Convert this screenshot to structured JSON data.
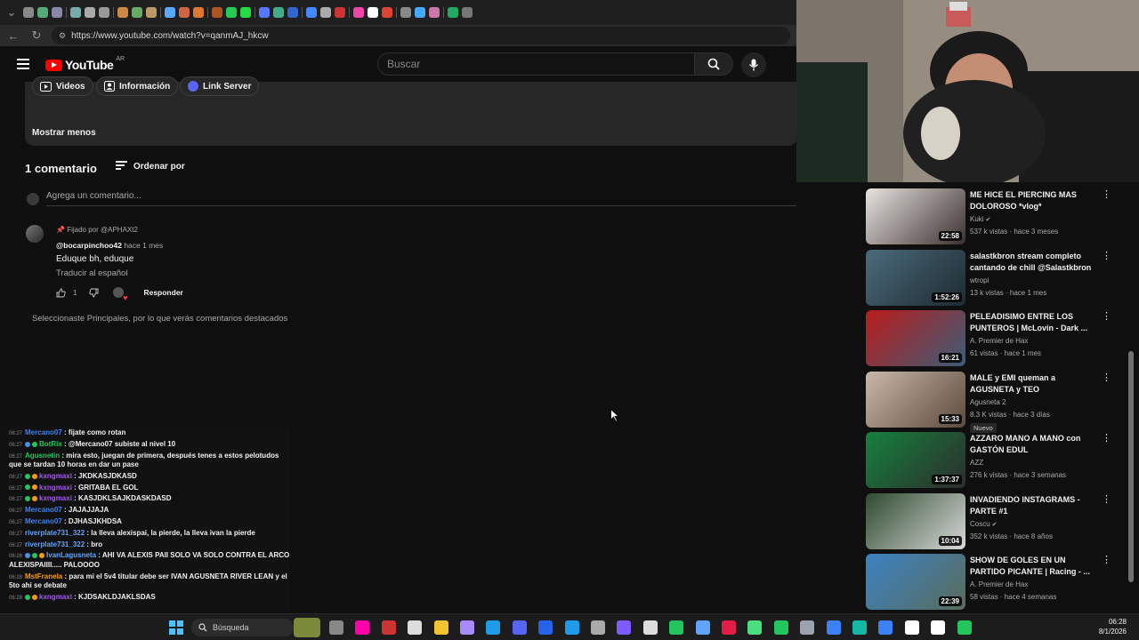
{
  "browser": {
    "url": "https://www.youtube.com/watch?v=qanmAJ_hkcw",
    "tab_icon_colors": [
      "#888",
      "#5a7",
      "#88a",
      "#7aa",
      "#aaa",
      "#999",
      "#c84",
      "#6a6",
      "#b96",
      "#5af",
      "#c64",
      "#d73",
      "#a52",
      "#2c5",
      "#2d4",
      "#57f",
      "#4a8",
      "#36c",
      "#48f",
      "#aaa",
      "#c33",
      "#e4a",
      "#fff",
      "#d43",
      "#888",
      "#4af",
      "#c7a",
      "#2a6",
      "#777"
    ]
  },
  "yt": {
    "logo_text": "YouTube",
    "region": "AR",
    "search_placeholder": "Buscar",
    "icons": {
      "menu": "hamburger-icon",
      "search": "search-icon",
      "mic": "mic-icon"
    }
  },
  "description": {
    "chips": [
      {
        "label": "Videos",
        "icon": "video-icon"
      },
      {
        "label": "Información",
        "icon": "person-icon"
      },
      {
        "label": "Link Server",
        "icon": "discord-icon"
      }
    ],
    "show_less": "Mostrar menos"
  },
  "comments": {
    "count_label": "1 comentario",
    "sort_label": "Ordenar por",
    "add_placeholder": "Agrega un comentario...",
    "filter_note": "Seleccionaste Principales, por lo que verás comentarios destacados",
    "items": [
      {
        "pinned": "Fijado por @APHAXt2",
        "author": "@bocarpinchoo42",
        "time": "hace 1 mes",
        "text": "Eduque bh, eduque",
        "translate": "Traducir al español",
        "likes": "1",
        "reply": "Responder"
      }
    ]
  },
  "chat": [
    {
      "time": "06:27",
      "user": "Mercano07",
      "color": "#3b82f6",
      "badges": [],
      "msg": ": fijate como rotan"
    },
    {
      "time": "06:27",
      "user": "BotRix",
      "color": "#22c55e",
      "badges": [
        "#4a90e2",
        "#22c55e"
      ],
      "msg": ": @Mercano07 subiste al nivel 10"
    },
    {
      "time": "06:27",
      "user": "Agusnetin",
      "color": "#22c55e",
      "badges": [],
      "msg": ": mira esto, juegan de primera, después tenes a estos pelotudos que se tardan 10 horas en dar un pase"
    },
    {
      "time": "06:27",
      "user": "kxngmaxi",
      "color": "#a855f7",
      "badges": [
        "#22c55e",
        "#f59e0b"
      ],
      "msg": ": JKDKASJDKASD"
    },
    {
      "time": "06:27",
      "user": "kxngmaxi",
      "color": "#a855f7",
      "badges": [
        "#22c55e",
        "#f59e0b"
      ],
      "msg": ": GRITABA EL GOL"
    },
    {
      "time": "06:27",
      "user": "kxngmaxi",
      "color": "#a855f7",
      "badges": [
        "#22c55e",
        "#f59e0b"
      ],
      "msg": ": KASJDKLSAJKDASKDASD"
    },
    {
      "time": "06:27",
      "user": "Mercano07",
      "color": "#3b82f6",
      "badges": [],
      "msg": ": JAJAJJAJA"
    },
    {
      "time": "06:27",
      "user": "Mercano07",
      "color": "#3b82f6",
      "badges": [],
      "msg": ": DJHASJKHDSA"
    },
    {
      "time": "06:27",
      "user": "riverplate731_322",
      "color": "#60a5fa",
      "badges": [],
      "msg": ": la lleva alexispai, la pierde, la lleva ivan la pierde"
    },
    {
      "time": "06:27",
      "user": "riverplate731_322",
      "color": "#60a5fa",
      "badges": [],
      "msg": ": bro"
    },
    {
      "time": "06:28",
      "user": "IvanLagusneta",
      "color": "#60a5fa",
      "badges": [
        "#4a90e2",
        "#22c55e",
        "#f59e0b"
      ],
      "msg": ": AHI VA ALEXIS PAII SOLO VA SOLO CONTRA EL ARCO ALEXISPAIIII..... PALOOOO"
    },
    {
      "time": "06:28",
      "user": "MstFranela",
      "color": "#f59e0b",
      "badges": [],
      "msg": ": para mi el 5v4 titular debe ser IVAN AGUSNETA RIVER LEAN y el 5to ahi se debate"
    },
    {
      "time": "06:28",
      "user": "kxngmaxi",
      "color": "#a855f7",
      "badges": [
        "#22c55e",
        "#f59e0b"
      ],
      "msg": ": KJDSAKLDJAKLSDAS"
    }
  ],
  "recs": [
    {
      "title": "ME HICE EL PIERCING MAS DOLOROSO *vlog*",
      "channel": "Kuki",
      "verified": true,
      "meta": "537 k vistas · hace 3 meses",
      "dur": "22:58",
      "thumb": [
        "#e8e4e0",
        "#3a3030"
      ],
      "badge": ""
    },
    {
      "title": "salastkbron stream completo cantando de chill @Salastkbron",
      "channel": "wtropi",
      "verified": false,
      "meta": "13 k vistas · hace 1 mes",
      "dur": "1:52:26",
      "thumb": [
        "#4a6b7c",
        "#1e2a30"
      ],
      "badge": ""
    },
    {
      "title": "PELEADISIMO ENTRE LOS PUNTEROS | McLovin - Dark ...",
      "channel": "A. Premier de Hax",
      "verified": false,
      "meta": "61 vistas · hace 1 mes",
      "dur": "16:21",
      "thumb": [
        "#b91c1c",
        "#3b5d78"
      ],
      "badge": ""
    },
    {
      "title": "MALE y EMI queman a AGUSNETA y TEO",
      "channel": "Agusneta 2",
      "verified": false,
      "meta": "8.3 K vistas · hace 3 días",
      "dur": "15:33",
      "thumb": [
        "#c9b8a8",
        "#5c4a3d"
      ],
      "badge": "Nuevo"
    },
    {
      "title": "AZZARO MANO A MANO con GASTÓN EDUL",
      "channel": "AZZ",
      "verified": false,
      "meta": "276 k vistas · hace 3 semanas",
      "dur": "1:37:37",
      "thumb": [
        "#15803d",
        "#2d2d2d"
      ],
      "badge": ""
    },
    {
      "title": "INVADIENDO INSTAGRAMS - PARTE #1",
      "channel": "Coscu",
      "verified": true,
      "meta": "352 k vistas · hace 8 años",
      "dur": "10:04",
      "thumb": [
        "#2e4a2f",
        "#d9d9d9"
      ],
      "badge": ""
    },
    {
      "title": "SHOW DE GOLES EN UN PARTIDO PICANTE | Racing - ...",
      "channel": "A. Premier de Hax",
      "verified": false,
      "meta": "58 vistas · hace 4 semanas",
      "dur": "22:39",
      "thumb": [
        "#3b82c4",
        "#5a6b5a"
      ],
      "badge": ""
    }
  ],
  "taskbar": {
    "search_placeholder": "Búsqueda",
    "time": "06:28",
    "date": "8/1/2026",
    "app_icon_colors": [
      "#888",
      "#f0a",
      "#c33",
      "#ddd",
      "#f4c430",
      "#a78bfa",
      "#1e9be9",
      "#5865f2",
      "#2563eb",
      "#1e9be9",
      "#aaa",
      "#7c5cff",
      "#ddd",
      "#22c55e",
      "#60a5fa",
      "#e11d48",
      "#4ade80",
      "#22c55e",
      "#9ca3af",
      "#3b82f6",
      "#14b8a6",
      "#3b82f6",
      "#fff",
      "#fff",
      "#22c55e"
    ]
  }
}
